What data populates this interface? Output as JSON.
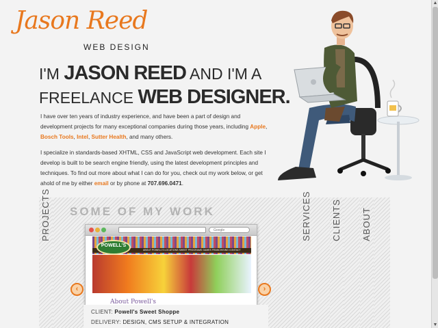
{
  "logo": {
    "script": "Jason Reed",
    "sub": "WEB DESIGN"
  },
  "headline": {
    "l1_pre": "I'M ",
    "l1_bold": "JASON REED",
    "l1_post": " AND I'M A",
    "l2_pre": "FREELANCE ",
    "l2_bold": "WEB DESIGNER",
    "l2_post": "."
  },
  "intro": {
    "p1_a": "I have over ten years of industry experience, and have been a part of design and development projects for many exceptional companies during those years, including ",
    "c1": "Apple",
    "sep1": ", ",
    "c2": "Bosch Tools",
    "sep2": ", ",
    "c3": "Intel",
    "sep3": ", ",
    "c4": "Sutter Health",
    "p1_b": ", and many others.",
    "p2_a": "I specialize in standards-based XHTML, CSS and JavaScript web development. Each site I develop is built to be search engine friendly, using the latest development principles and techniques. To find out more about what I can do for you, check out my work below, or get ahold of me by either ",
    "email": "email",
    "p2_b": " or by phone at ",
    "phone": "707.696.0471",
    "p2_c": "."
  },
  "work": {
    "title": "SOME OF MY WORK",
    "tabs": [
      "PROJECTS",
      "SERVICES",
      "CLIENTS",
      "ABOUT"
    ],
    "client_label": "CLIENT: ",
    "client": "Powell's Sweet Shoppe",
    "delivery_label": "DELIVERY: ",
    "delivery": "DESIGN, CMS SETUP & INTEGRATION",
    "prev": "‹",
    "next": "›"
  },
  "screenshot": {
    "logo_top": "POWELL'S",
    "logo_bottom": "SWEET SHOPPE",
    "nav": "ABOUT POWELL'S   LOCATIONS   SWEET PROGRAMS   GAMES   FRANCHISING   CONTACT",
    "about": "About Powell's",
    "search": "Google"
  },
  "colors": {
    "accent": "#e8781e",
    "background": "#f3f3f3"
  },
  "scroll": {
    "up": "▲",
    "down": "▼"
  }
}
